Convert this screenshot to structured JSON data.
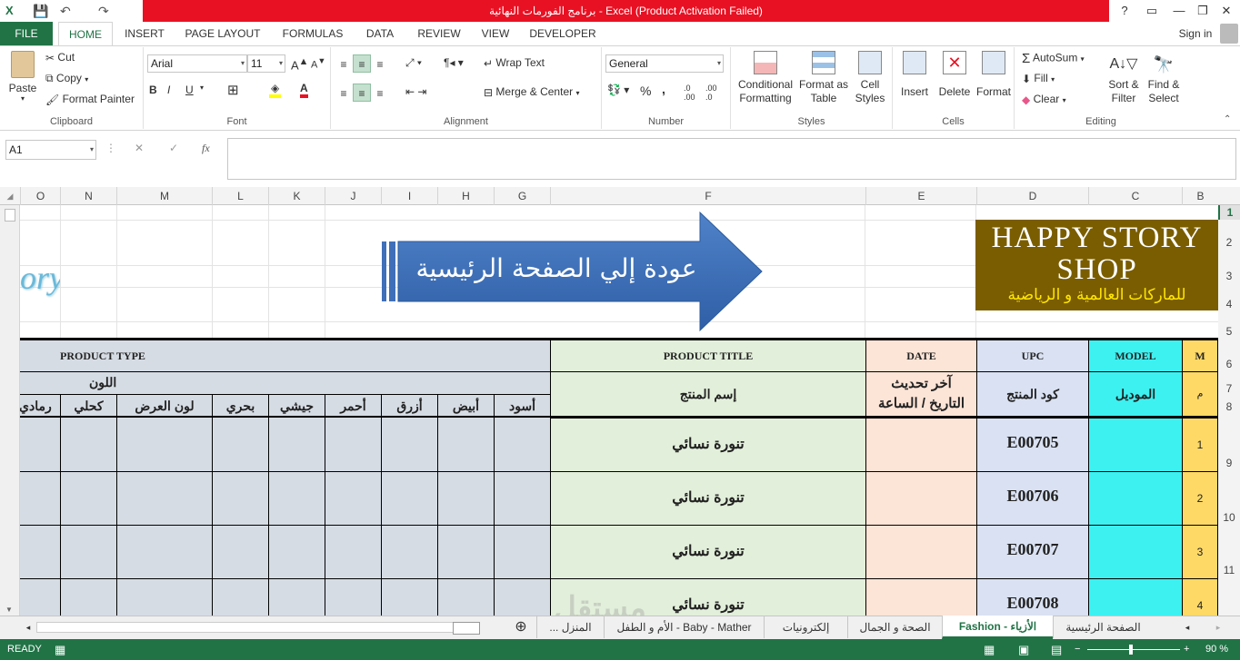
{
  "window": {
    "title": "برنامج الفورمات النهائية  -  Excel (Product Activation Failed)",
    "help": "?",
    "minimize": "—",
    "restore": "❐",
    "close": "✕"
  },
  "qat": {
    "save": "💾",
    "undo": "↶",
    "redo": "↷"
  },
  "ribbon_tabs": [
    "FILE",
    "HOME",
    "INSERT",
    "PAGE LAYOUT",
    "FORMULAS",
    "DATA",
    "REVIEW",
    "VIEW",
    "DEVELOPER"
  ],
  "signin": "Sign in",
  "clipboard": {
    "paste": "Paste",
    "cut": "Cut",
    "copy": "Copy",
    "format_painter": "Format Painter",
    "label": "Clipboard"
  },
  "font": {
    "name": "Arial",
    "size": "11",
    "bold": "B",
    "italic": "I",
    "underline": "U",
    "label": "Font"
  },
  "alignment": {
    "wrap": "Wrap Text",
    "merge": "Merge & Center",
    "label": "Alignment"
  },
  "number": {
    "format": "General",
    "percent": "%",
    "comma": ",",
    "label": "Number"
  },
  "styles": {
    "conditional": "Conditional Formatting",
    "format_table": "Format as Table",
    "cell_styles": "Cell Styles",
    "label": "Styles"
  },
  "cells": {
    "insert": "Insert",
    "delete": "Delete",
    "format": "Format",
    "label": "Cells"
  },
  "editing": {
    "autosum": "AutoSum",
    "fill": "Fill",
    "clear": "Clear",
    "sort": "Sort & Filter",
    "find": "Find & Select",
    "label": "Editing"
  },
  "formula_bar": {
    "name_box": "A1",
    "fx": "fx",
    "cancel": "✕",
    "enter": "✓",
    "content": ""
  },
  "columns": [
    "O",
    "N",
    "M",
    "L",
    "K",
    "J",
    "I",
    "H",
    "G",
    "F",
    "E",
    "D",
    "C",
    "B"
  ],
  "rows": [
    "1",
    "2",
    "3",
    "4",
    "5",
    "6",
    "7",
    "8",
    "9",
    "10",
    "11"
  ],
  "sheet": {
    "logo_line1": "HAPPY STORY",
    "logo_line2": "SHOP",
    "logo_sub": "للماركات العالمية و الرياضية",
    "logo_partial": "ory",
    "arrow_text": "عودة إلي الصفحة الرئيسية",
    "hdr_m": "M",
    "hdr_model": "MODEL",
    "hdr_upc": "UPC",
    "hdr_date": "DATE",
    "hdr_title": "PRODUCT TITLE",
    "hdr_type": "PRODUCT TYPE",
    "ar_m": "م",
    "ar_model": "الموديل",
    "ar_upc": "كود المنتج",
    "ar_date": "آخر تحديث التاريخ / الساعة",
    "ar_title": "إسم المنتج",
    "ar_color": "اللون",
    "colors": [
      "أسود",
      "أبيض",
      "أزرق",
      "أحمر",
      "جيشي",
      "بحري",
      "لون العرض",
      "كحلي",
      "رمادي"
    ],
    "rows": [
      {
        "n": "1",
        "upc": "E00705",
        "title": "تنورة نسائي"
      },
      {
        "n": "2",
        "upc": "E00706",
        "title": "تنورة نسائي"
      },
      {
        "n": "3",
        "upc": "E00707",
        "title": "تنورة نسائي"
      },
      {
        "n": "4",
        "upc": "E00708",
        "title": "تنورة نسائي"
      }
    ]
  },
  "sheet_tabs": [
    "الصفحة الرئيسية",
    "Fashion - الأزياء",
    "الصحة و الجمال",
    "إلكترونيات",
    "Baby - Mather - الأم و الطفل",
    "المنزل ..."
  ],
  "status": {
    "ready": "READY",
    "zoom": "90 %"
  },
  "watermark": "مستقل"
}
